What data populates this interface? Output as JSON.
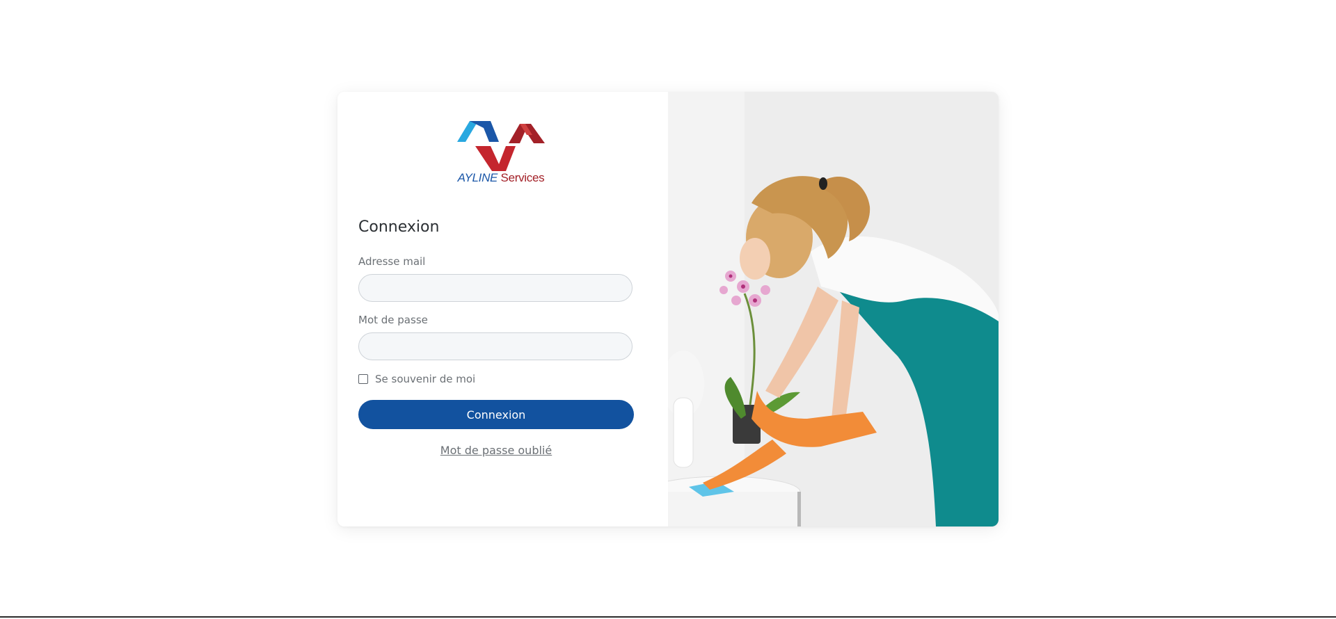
{
  "brand": {
    "name_part1": "AYLINE",
    "name_part2": "Services",
    "colors": {
      "blue": "#1b57a8",
      "light_blue": "#29a8e0",
      "red": "#a32128"
    }
  },
  "login": {
    "title": "Connexion",
    "email_label": "Adresse mail",
    "email_value": "",
    "password_label": "Mot de passe",
    "password_value": "",
    "remember_label": "Se souvenir de moi",
    "remember_checked": false,
    "submit_label": "Connexion",
    "forgot_label": "Mot de passe oublié",
    "accent_color": "#12529f"
  },
  "hero": {
    "icon": "cleaning-woman-photo"
  }
}
